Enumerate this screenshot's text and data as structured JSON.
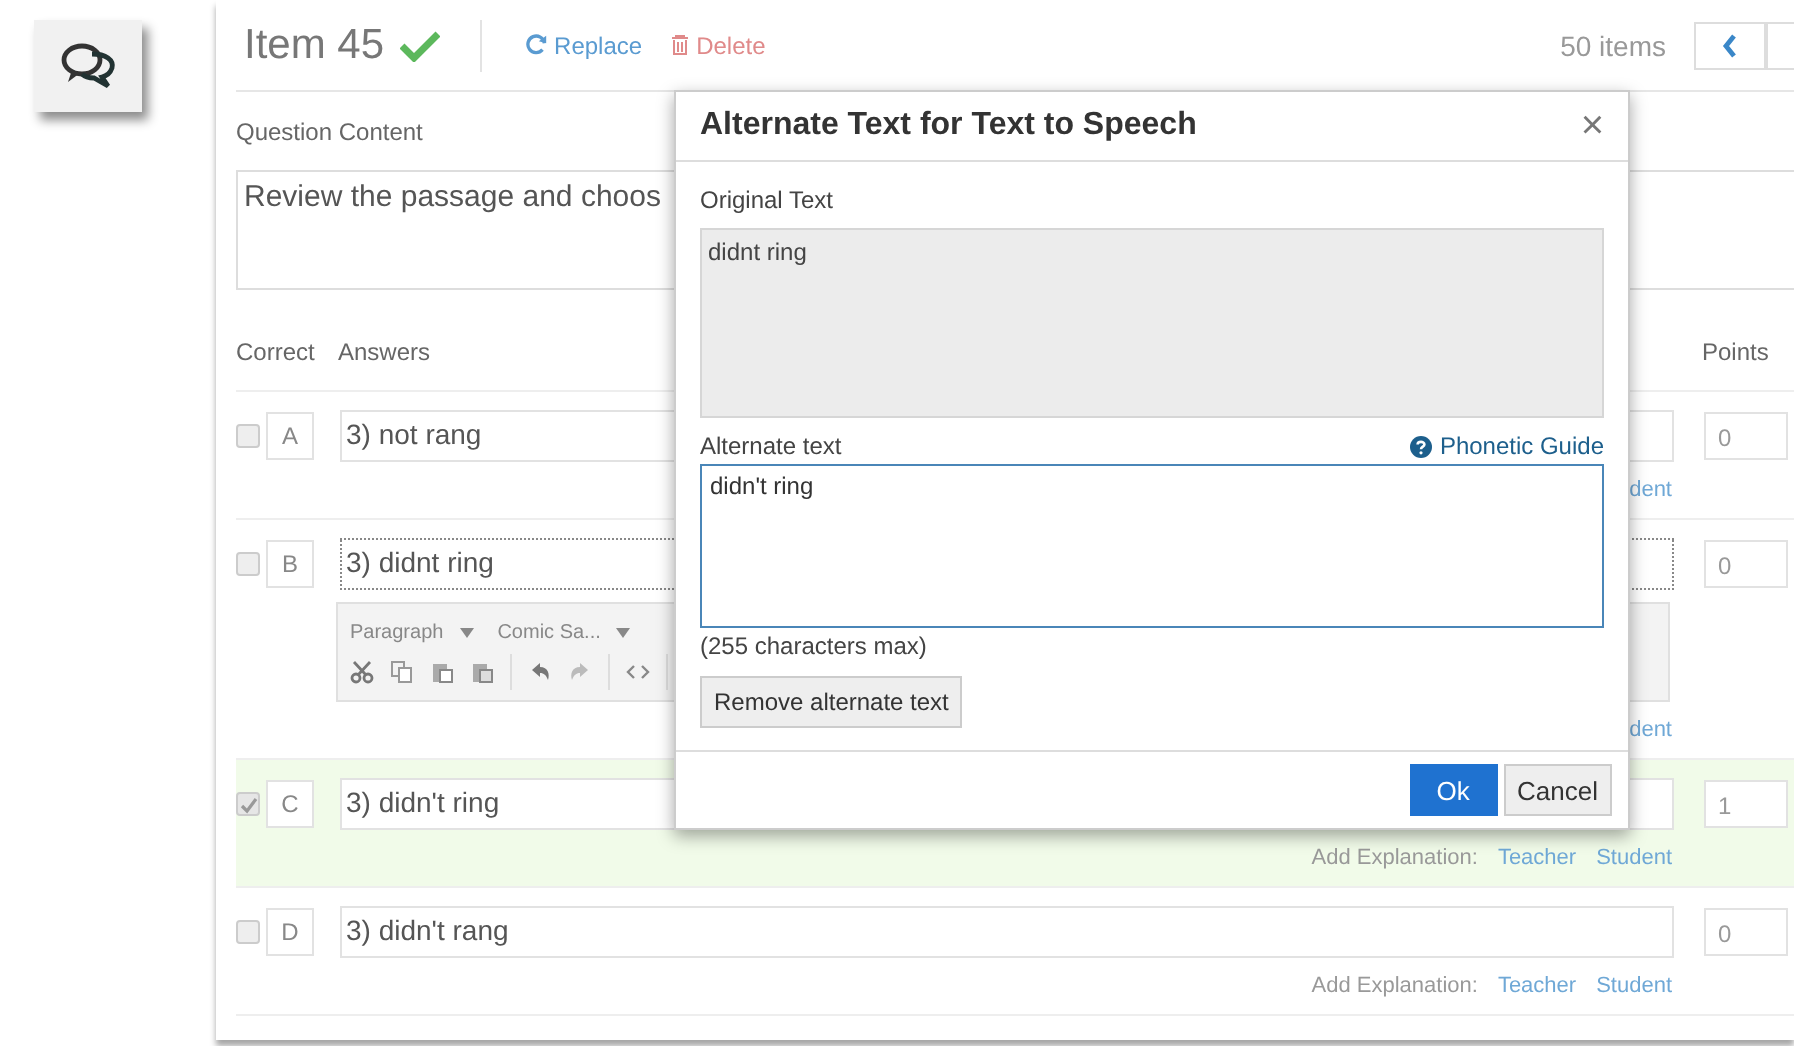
{
  "header": {
    "title": "Item 45",
    "verified": true,
    "actions": [
      {
        "label": "Replace",
        "kind": "replace"
      },
      {
        "label": "Delete",
        "kind": "delete"
      }
    ],
    "count": "50 items"
  },
  "question": {
    "label": "Question Content",
    "text": "Review the passage and choos"
  },
  "columns": [
    "Correct",
    "Answers",
    "Points"
  ],
  "answers": [
    {
      "letter": "A",
      "text": "3) not rang",
      "checked": false,
      "editing": false,
      "points": "0",
      "explanation": [
        {
          "label": "dent",
          "kind": "link"
        }
      ]
    },
    {
      "letter": "B",
      "text": "3) didnt ring",
      "checked": false,
      "editing": true,
      "points": "0",
      "toolbar": {
        "format": "Paragraph",
        "font": "Comic Sa..."
      },
      "explanation": [
        {
          "label": "dent",
          "kind": "link"
        }
      ]
    },
    {
      "letter": "C",
      "text": "3) didn't ring",
      "checked": true,
      "editing": false,
      "points": "1",
      "explanation": [
        {
          "label": "Add Explanation:",
          "kind": "label"
        },
        {
          "label": "Teacher",
          "kind": "link"
        },
        {
          "label": "Student",
          "kind": "link"
        }
      ]
    },
    {
      "letter": "D",
      "text": "3) didn't rang",
      "checked": false,
      "editing": false,
      "points": "0",
      "explanation": [
        {
          "label": "Add Explanation:",
          "kind": "label"
        },
        {
          "label": "Teacher",
          "kind": "link"
        },
        {
          "label": "Student",
          "kind": "link"
        }
      ]
    }
  ],
  "dialog": {
    "title": "Alternate Text for Text to Speech",
    "close": "×",
    "original_label": "Original Text",
    "original_text": "didnt ring",
    "alt_label": "Alternate text",
    "phonetic_link": "Phonetic Guide",
    "alt_value": "didn't ring",
    "hint": "(255 characters max)",
    "remove_button": "Remove alternate text",
    "buttons": [
      {
        "label": "Ok",
        "kind": "primary"
      },
      {
        "label": "Cancel",
        "kind": "secondary"
      }
    ]
  }
}
